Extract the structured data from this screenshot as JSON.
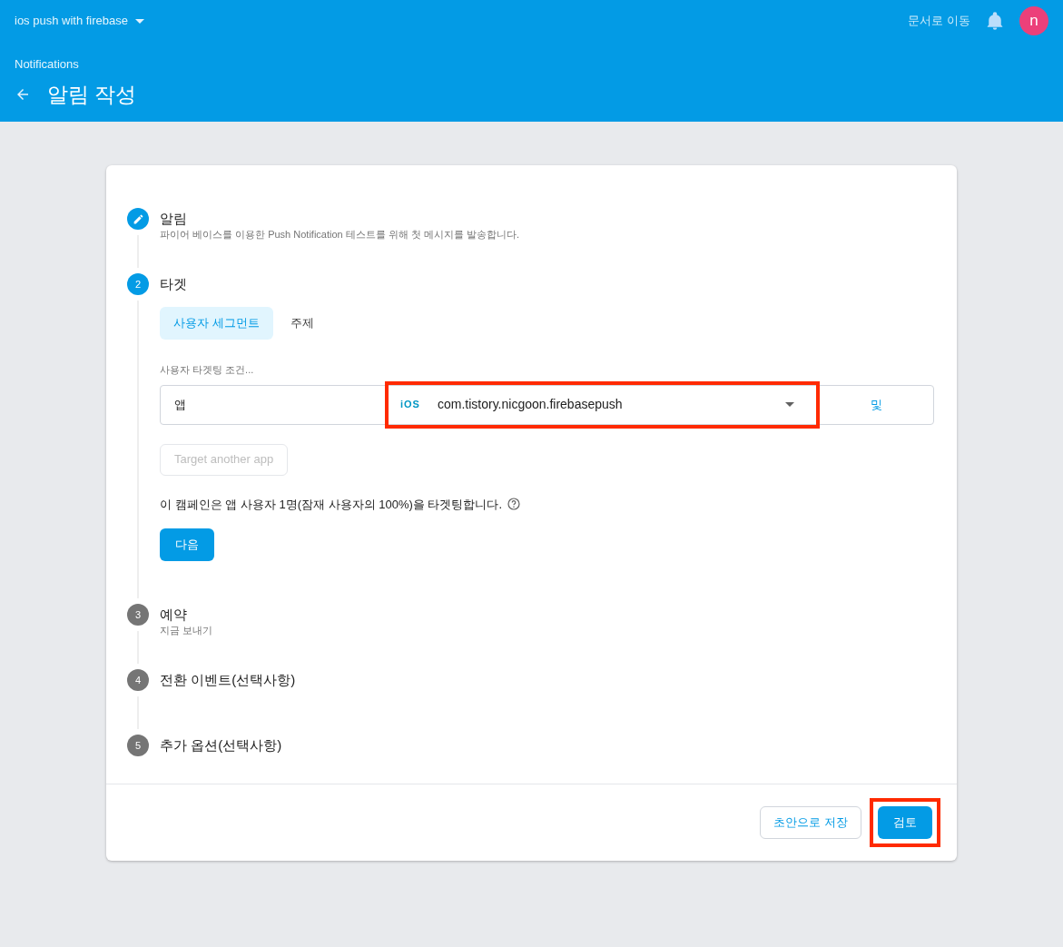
{
  "top_bar": {
    "project": "ios push with firebase",
    "docs_link": "문서로 이동",
    "avatar": "n"
  },
  "header": {
    "breadcrumb": "Notifications",
    "title": "알림 작성"
  },
  "steps": [
    {
      "kind": "done",
      "title": "알림",
      "subtitle": "파이어 베이스를 이용한 Push Notification 테스트를 위해 첫 메시지를 발송합니다."
    },
    {
      "kind": "active",
      "number": "2",
      "title": "타겟"
    },
    {
      "kind": "pending",
      "number": "3",
      "title": "예약",
      "subtitle": "지금 보내기"
    },
    {
      "kind": "pending",
      "number": "4",
      "title": "전환 이벤트(선택사항)"
    },
    {
      "kind": "pending",
      "number": "5",
      "title": "추가 옵션(선택사항)"
    }
  ],
  "target": {
    "tabs": [
      {
        "label": "사용자 세그먼트",
        "selected": true
      },
      {
        "label": "주제",
        "selected": false
      }
    ],
    "condition_label": "사용자 타겟팅 조건...",
    "condition": {
      "field": "앱",
      "platform": "iOS",
      "app": "com.tistory.nicgoon.firebasepush",
      "highlighted": true,
      "conjunction": "및"
    },
    "add_app_button": {
      "label": "Target another app",
      "disabled": true
    },
    "summary": "이 캠페인은 앱 사용자 1명(잠재 사용자의 100%)을 타겟팅합니다.",
    "next_button": "다음"
  },
  "footer": {
    "save_draft": "초안으로 저장",
    "review": {
      "label": "검토",
      "highlighted": true
    }
  }
}
